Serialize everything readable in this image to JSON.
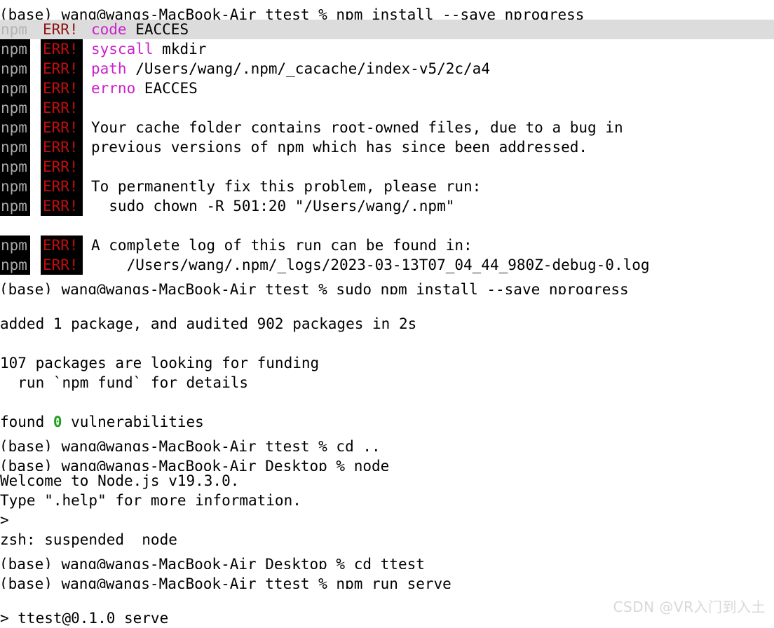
{
  "terminal": {
    "title": "Terminal — zsh",
    "colors": {
      "background": "#ffffff",
      "foreground": "#000000",
      "highlight_background": "#dcdcdc",
      "badge_background": "#000000",
      "badge_npm_text": "#a8a8a8",
      "badge_err_text": "#c40d0d",
      "keyword_magenta": "#cc1fcc",
      "success_green": "#20a020",
      "watermark": "#d8d8d8"
    },
    "prompt_bracket": "[",
    "badge_npm_label": "npm",
    "badge_err_label": "ERR!",
    "lines": {
      "cmd_install": "(base) wang@wangs-MacBook-Air ttest % npm install --save nprogress",
      "err_code_key": "code",
      "err_code_val": "EACCES",
      "err_syscall_key": "syscall",
      "err_syscall_val": "mkdir",
      "err_path_key": "path",
      "err_path_val": "/Users/wang/.npm/_cacache/index-v5/2c/a4",
      "err_errno_key": "errno",
      "err_errno_val": "EACCES",
      "err_msg_1": "Your cache folder contains root-owned files, due to a bug in",
      "err_msg_2": "previous versions of npm which has since been addressed.",
      "err_msg_3": "To permanently fix this problem, please run:",
      "err_msg_4": "  sudo chown -R 501:20 \"/Users/wang/.npm\"",
      "err_log_1": "A complete log of this run can be found in:",
      "err_log_2": "    /Users/wang/.npm/_logs/2023-03-13T07_04_44_980Z-debug-0.log",
      "cmd_sudo_install": "(base) wang@wangs-MacBook-Air ttest % sudo npm install --save nprogress",
      "out_added": "added 1 package, and audited 902 packages in 2s",
      "out_funding_1": "107 packages are looking for funding",
      "out_funding_2": "  run `npm fund` for details",
      "out_found_prefix": "found ",
      "out_found_count": "0",
      "out_found_suffix": " vulnerabilities",
      "cmd_cd_up": "(base) wang@wangs-MacBook-Air ttest % cd ..",
      "cmd_node": "(base) wang@wangs-MacBook-Air Desktop % node",
      "out_node_welcome": "Welcome to Node.js v19.3.0.",
      "out_node_help": "Type \".help\" for more information.",
      "out_node_prompt": ">",
      "out_suspended": "zsh: suspended  node",
      "cmd_cd_ttest": "(base) wang@wangs-MacBook-Air Desktop % cd ttest",
      "cmd_npm_run_serve": "(base) wang@wangs-MacBook-Air ttest % npm run serve",
      "out_serve_script": "> ttest@0.1.0 serve"
    }
  },
  "watermark": {
    "text": "CSDN @VR入门到入土"
  }
}
